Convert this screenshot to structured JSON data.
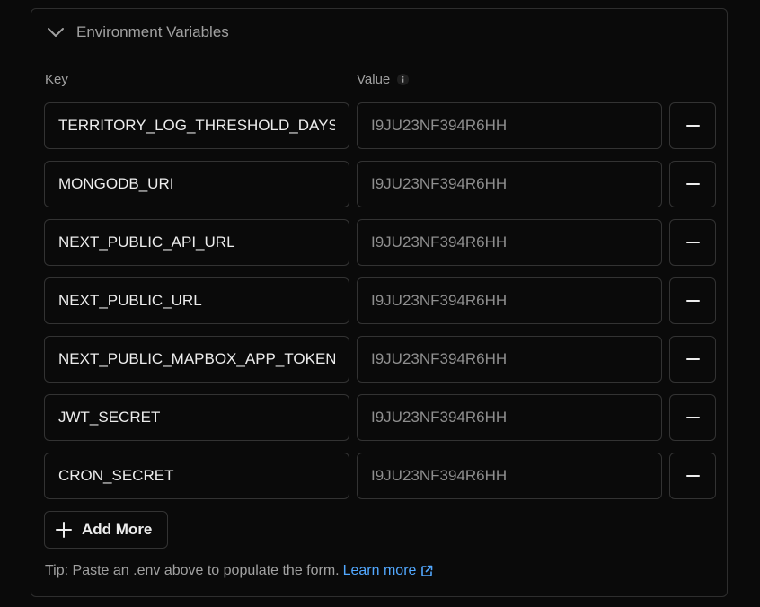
{
  "section": {
    "title": "Environment Variables"
  },
  "columns": {
    "key_label": "Key",
    "value_label": "Value"
  },
  "variables": [
    {
      "key": "TERRITORY_LOG_THRESHOLD_DAYS",
      "value": "I9JU23NF394R6HH"
    },
    {
      "key": "MONGODB_URI",
      "value": "I9JU23NF394R6HH"
    },
    {
      "key": "NEXT_PUBLIC_API_URL",
      "value": "I9JU23NF394R6HH"
    },
    {
      "key": "NEXT_PUBLIC_URL",
      "value": "I9JU23NF394R6HH"
    },
    {
      "key": "NEXT_PUBLIC_MAPBOX_APP_TOKEN",
      "value": "I9JU23NF394R6HH"
    },
    {
      "key": "JWT_SECRET",
      "value": "I9JU23NF394R6HH"
    },
    {
      "key": "CRON_SECRET",
      "value": "I9JU23NF394R6HH"
    }
  ],
  "actions": {
    "add_more_label": "Add More"
  },
  "tip": {
    "text": "Tip: Paste an .env above to populate the form.",
    "link_label": "Learn more"
  },
  "colors": {
    "background": "#0a0a0a",
    "border": "#333333",
    "text": "#ededed",
    "muted_text": "#a1a1a1",
    "link": "#52a8ff"
  },
  "icons": {
    "collapse": "chevron-down-icon",
    "info": "info-icon",
    "remove": "minus-icon",
    "add": "plus-icon",
    "external": "external-link-icon"
  }
}
